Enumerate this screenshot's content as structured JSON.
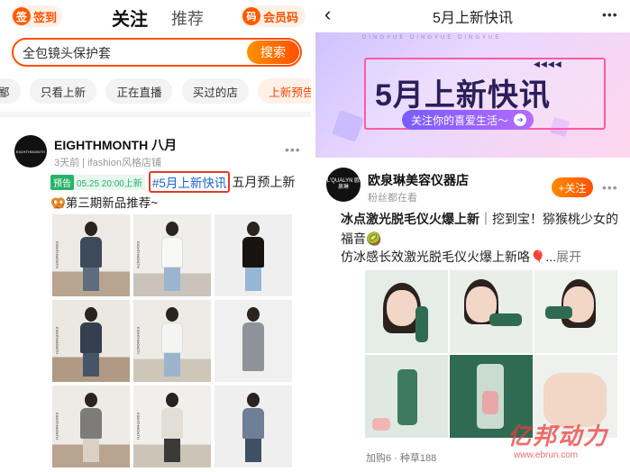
{
  "left": {
    "nav": {
      "signin": "签到",
      "signin_icon": "签",
      "tab_follow": "关注",
      "tab_recommend": "推荐",
      "member": "会员码",
      "member_icon": "码"
    },
    "search": {
      "value": "全包镜头保护套",
      "button": "搜索"
    },
    "chips": [
      "鄙",
      "只看上新",
      "正在直播",
      "买过的店",
      "上新预告"
    ],
    "post": {
      "avatar_text": "EIGHTHMONTH",
      "name": "EIGHTHMONTH 八月",
      "meta": "3天前 | ifashion风格店铺",
      "badge": "预告",
      "badge_time": "05.25 20:00上新",
      "topic": "#5月上新快讯",
      "text_tail": "五月预上新",
      "line2": "🥨第三期新品推荐~",
      "photo_brand": "EIGHTHMONTH"
    }
  },
  "right": {
    "header_title": "5月上新快讯",
    "banner": {
      "headline": "5月上新快讯",
      "pill": "关注你的喜爱生活～",
      "tiny": "DINGYUE   DINGYUE   DINGYUE"
    },
    "shop": {
      "avatar_text": "L'QUALYN 欧泉琳",
      "name": "欧泉琳美容仪器店",
      "meta": "粉丝都在看",
      "follow": "+关注"
    },
    "text_line1a": "冰点激光脱毛仪火爆上新",
    "text_line1b": "｜挖到宝！猕猴桃少女的福音🥝",
    "text_line2": "仿冰感长效激光脱毛仪火爆上新咯🎈...",
    "text_more": "展开",
    "footer": "加购6 · 种草188",
    "watermark": "亿邦动力",
    "watermark_url": "www.ebrun.com"
  }
}
